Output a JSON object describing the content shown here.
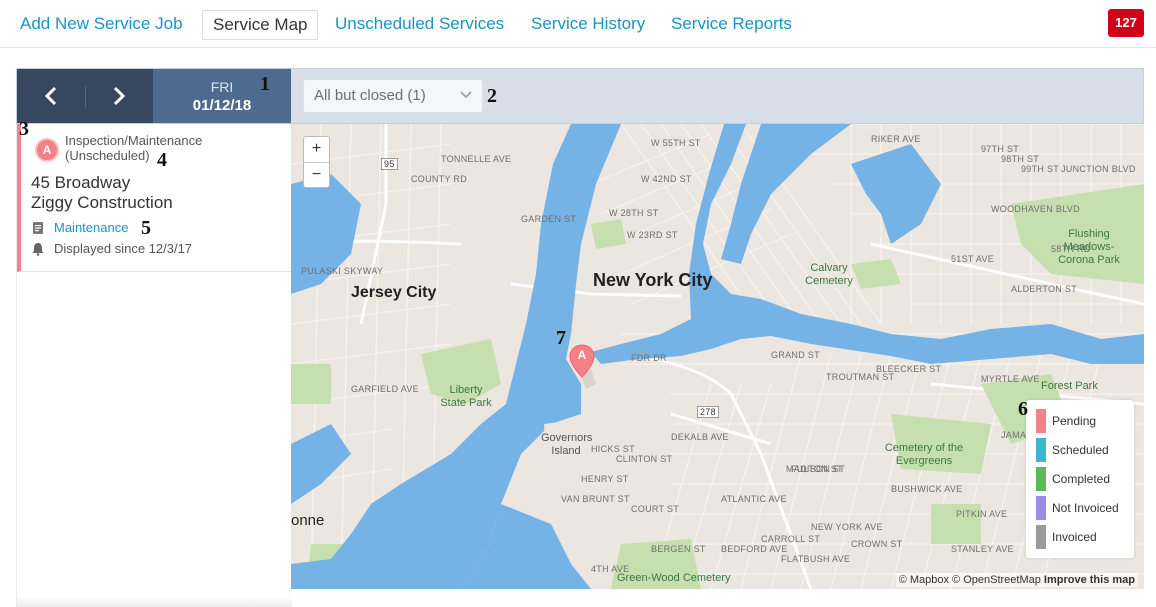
{
  "nav": {
    "items": [
      {
        "label": "Add New Service Job",
        "active": false
      },
      {
        "label": "Service Map",
        "active": true
      },
      {
        "label": "Unscheduled Services",
        "active": false
      },
      {
        "label": "Service History",
        "active": false
      },
      {
        "label": "Service Reports",
        "active": false
      }
    ],
    "badge": "127",
    "badge_color": "#d0021b"
  },
  "toolbar": {
    "prev_icon": "chevron-left-icon",
    "next_icon": "chevron-right-icon",
    "date_dow": "FRI",
    "date_value": "01/12/18",
    "filter_value": "All but closed (1)"
  },
  "job": {
    "marker": "A",
    "type": "Inspection/Maintenance (Unscheduled)",
    "address": "45 Broadway",
    "company": "Ziggy Construction",
    "category_link": "Maintenance",
    "since": "Displayed since 12/3/17",
    "accent_color": "#f2838a"
  },
  "map": {
    "zoom_in": "+",
    "zoom_out": "−",
    "pin_letter": "A",
    "cities": [
      "New York City",
      "Jersey City"
    ],
    "areas": [
      "Liberty State Park",
      "Governors Island",
      "Calvary Cemetery",
      "Flushing Meadows-Corona Park",
      "Cemetery of the Evergreens",
      "Forest Park",
      "Green-Wood Cemetery"
    ],
    "streets": [
      "W 55TH ST",
      "W 42ND ST",
      "W 28TH ST",
      "W 23RD ST",
      "PULASKI SKYWAY",
      "COUNTY RD",
      "TONNELLE AVE",
      "GARDEN ST",
      "FDR DR",
      "GRAND ST",
      "MYRTLE AVE",
      "DEKALB AVE",
      "FULTON ST",
      "COURT ST",
      "ATLANTIC AVE",
      "CLINTON ST",
      "HICKS ST",
      "HENRY ST",
      "BERGEN ST",
      "NEW YORK AVE",
      "FLATBUSH AVE",
      "MADISON ST",
      "BUSHWICK AVE",
      "BLEECKER ST",
      "TROUTMAN ST",
      "STANLEY AVE",
      "PITKIN AVE",
      "JAMAICA AVE",
      "51ST AVE",
      "ALDERTON ST",
      "WOODHAVEN BLVD",
      "97TH ST",
      "98TH ST",
      "99TH ST",
      "58TH RD",
      "RIKER AVE",
      "GARFIELD AVE",
      "BEDFORD AVE",
      "VAN BRUNT ST",
      "JUNCTION BLVD",
      "CROWN ST",
      "CARROLL ST",
      "4TH AVE"
    ],
    "shields": [
      "95",
      "278"
    ],
    "neighborhood_fragment": "onne",
    "attribution_1": "© Mapbox © OpenStreetMap",
    "attribution_2": "Improve this map",
    "water_color": "#75b2e5",
    "land_color": "#ebe6df",
    "park_color": "#c6dfae"
  },
  "legend": [
    {
      "label": "Pending",
      "color": "#f2838a"
    },
    {
      "label": "Scheduled",
      "color": "#3ab6cf"
    },
    {
      "label": "Completed",
      "color": "#5cb85c"
    },
    {
      "label": "Not Invoiced",
      "color": "#9b8ce6"
    },
    {
      "label": "Invoiced",
      "color": "#9b9b9b"
    }
  ],
  "annotations": [
    "1",
    "2",
    "3",
    "4",
    "5",
    "6",
    "7"
  ]
}
